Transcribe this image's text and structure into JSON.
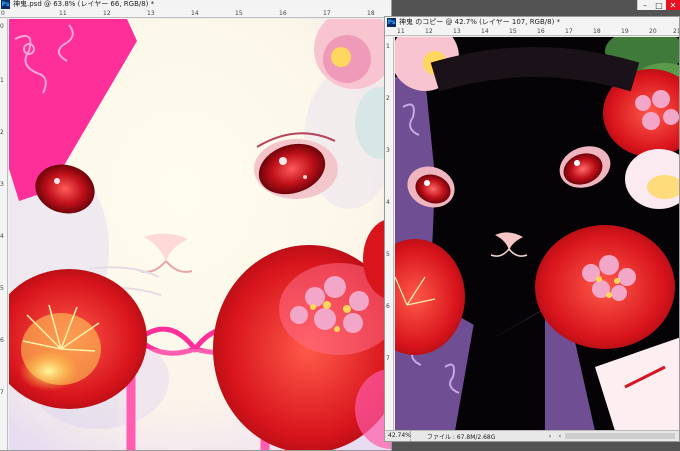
{
  "left_window": {
    "title": "神鬼.psd @ 63.8% (レイヤー 66, RGB/8) *",
    "ruler_h": [
      "0",
      "11",
      "12",
      "13",
      "14",
      "15",
      "16",
      "17",
      "18"
    ],
    "ruler_v": [
      "0",
      "1",
      "2",
      "3",
      "4",
      "5",
      "6",
      "7"
    ]
  },
  "right_window": {
    "title": "神鬼 のコピー @ 42.7% (レイヤー 107, RGB/8) *",
    "ruler_h": [
      "11",
      "12",
      "13",
      "14",
      "15",
      "16",
      "17",
      "18",
      "19",
      "20",
      "21"
    ],
    "ruler_v": [
      "1",
      "2",
      "3",
      "4",
      "5",
      "6",
      "7"
    ],
    "status": {
      "zoom": "42.74%",
      "file_info": "ファイル : 67.8M/2.68G"
    }
  },
  "icons": {
    "app": "photoshop-icon",
    "minimize": "minimize-icon",
    "maximize": "maximize-icon",
    "close": "close-icon"
  },
  "colors": {
    "app_bg": "#535353",
    "close_button": "#e81123",
    "ps_badge_bg": "#0b2a66",
    "ps_badge_fg": "#31a8ff"
  }
}
